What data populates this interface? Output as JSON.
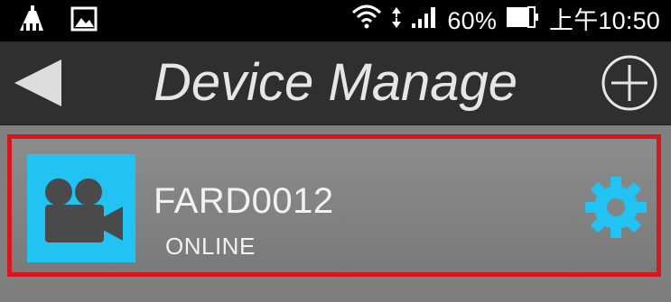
{
  "status_bar": {
    "left_icons": [
      "cleaner-icon",
      "image-icon"
    ],
    "right_icons": [
      "wifi-icon",
      "data-arrows-icon",
      "signal-icon",
      "battery-icon"
    ],
    "battery_percent": "60%",
    "time": "上午10:50"
  },
  "header": {
    "title": "Device Manage",
    "back_icon": "back-arrow-icon",
    "add_icon": "add-circle-icon"
  },
  "devices": [
    {
      "name": "FARD0012",
      "status": "ONLINE",
      "thumbnail_icon": "video-camera-icon",
      "settings_icon": "gear-icon"
    }
  ],
  "colors": {
    "status_bar": "#000000",
    "title_bar": "#2f2f2f",
    "list_background": "#808080",
    "highlight_border": "#d7161e",
    "accent": "#21c3f3"
  }
}
